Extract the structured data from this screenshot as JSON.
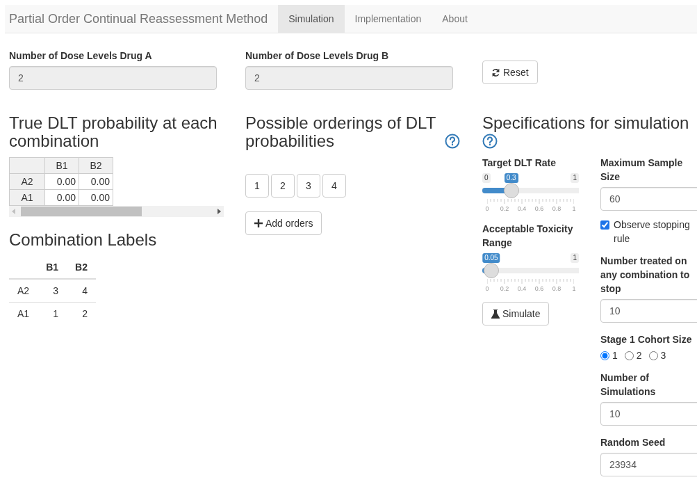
{
  "navbar": {
    "brand": "Partial Order Continual Reassessment Method",
    "tabs": [
      {
        "label": "Simulation",
        "selected": true
      },
      {
        "label": "Implementation",
        "selected": false
      },
      {
        "label": "About",
        "selected": false
      }
    ]
  },
  "dose_inputs": [
    {
      "label": "Number of Dose Levels Drug A",
      "value": "2"
    },
    {
      "label": "Number of Dose Levels Drug B",
      "value": "2"
    }
  ],
  "reset_button": "Reset",
  "true_dlt": {
    "title": "True DLT probability at each combination",
    "columns": [
      "B1",
      "B2"
    ],
    "rows": [
      {
        "header": "A2",
        "cells": [
          "0.00",
          "0.00"
        ]
      },
      {
        "header": "A1",
        "cells": [
          "0.00",
          "0.00"
        ]
      }
    ]
  },
  "combination_labels": {
    "title": "Combination Labels",
    "columns": [
      "B1",
      "B2"
    ],
    "rows": [
      {
        "header": "A2",
        "cells": [
          "3",
          "4"
        ]
      },
      {
        "header": "A1",
        "cells": [
          "1",
          "2"
        ]
      }
    ]
  },
  "orderings": {
    "title": "Possible orderings of DLT probabilities",
    "order_buttons": [
      "1",
      "2",
      "3",
      "4"
    ],
    "add_button": "Add orders"
  },
  "specs": {
    "title": "Specifications for simulation",
    "sliders": [
      {
        "label": "Target DLT Rate",
        "min_label": "0",
        "max_label": "1",
        "value_label": "0.3",
        "level": 0.3,
        "ticks": [
          "0",
          "0.2",
          "0.4",
          "0.6",
          "0.8",
          "1"
        ]
      },
      {
        "label": "Acceptable Toxicity Range",
        "max_label": "1",
        "value_label": "0.05",
        "level": 0.05,
        "ticks": [
          "0",
          "0.2",
          "0.4",
          "0.6",
          "0.8",
          "1"
        ]
      }
    ],
    "simulate_button": "Simulate",
    "max_sample": {
      "label": "Maximum Sample Size",
      "value": "60"
    },
    "stopping": {
      "label": "Observe stopping rule",
      "checked": true
    },
    "stop_number": {
      "label": "Number treated on any combination to stop",
      "value": "10"
    },
    "cohort": {
      "label": "Stage 1 Cohort Size",
      "options": [
        {
          "label": "1",
          "selected": true
        },
        {
          "label": "2",
          "selected": false
        },
        {
          "label": "3",
          "selected": false
        }
      ]
    },
    "nsims": {
      "label": "Number of Simulations",
      "value": "10"
    },
    "seed": {
      "label": "Random Seed",
      "value": "23934"
    }
  }
}
